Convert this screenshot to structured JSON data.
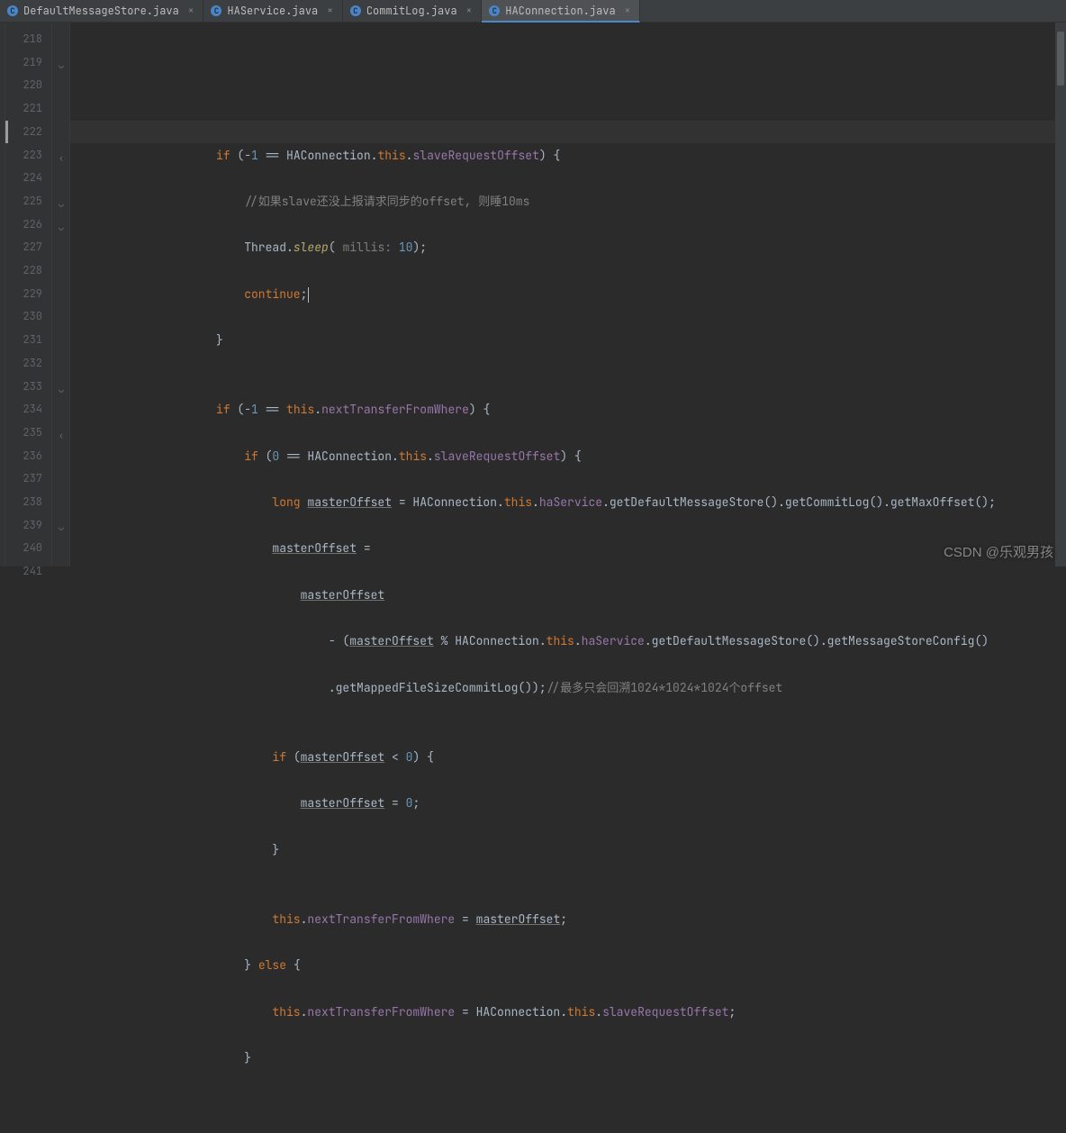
{
  "tabs": [
    {
      "label": "DefaultMessageStore.java"
    },
    {
      "label": "HAService.java"
    },
    {
      "label": "CommitLog.java"
    },
    {
      "label": "HAConnection.java"
    }
  ],
  "lines": {
    "start": 218,
    "end": 241
  },
  "code": {
    "t01": "if",
    "t02": " (-",
    "t03": "1",
    "t04": " == HAConnection.",
    "t05": "this",
    "t06": ".",
    "t07": "slaveRequestOffset",
    "t08": ") {",
    "t09": "//如果slave还没上报请求同步的offset, 则睡10ms",
    "t10": "Thread.",
    "t11": "sleep",
    "t12": "(",
    "t13": " millis: ",
    "t14": "10",
    "t15": ");",
    "t16": "continue",
    "t17": ";",
    "t18": "}",
    "t19": "if",
    "t20": " (-",
    "t21": "1",
    "t22": " == ",
    "t23": "this",
    "t24": ".",
    "t25": "nextTransferFromWhere",
    "t26": ") {",
    "t27": "if",
    "t28": " (",
    "t29": "0",
    "t30": " == HAConnection.",
    "t31": "this",
    "t32": ".",
    "t33": "slaveRequestOffset",
    "t34": ") {",
    "t35": "long",
    "t36": " ",
    "t37": "masterOffset",
    "t38": " = HAConnection.",
    "t39": "this",
    "t40": ".",
    "t41": "haService",
    "t42": ".getDefaultMessageStore().getCommitLog().getMaxOffset();",
    "t43": "masterOffset",
    "t44": " =",
    "t45": "masterOffset",
    "t46": "- (",
    "t47": "masterOffset",
    "t48": " % HAConnection.",
    "t49": "this",
    "t50": ".",
    "t51": "haService",
    "t52": ".getDefaultMessageStore().getMessageStoreConfig()",
    "t53": ".getMappedFileSizeCommitLog());",
    "t54": "//最多只会回溯1024*1024*1024个offset",
    "t55": "if",
    "t56": " (",
    "t57": "masterOffset",
    "t58": " < ",
    "t59": "0",
    "t60": ") {",
    "t61": "masterOffset",
    "t62": " = ",
    "t63": "0",
    "t64": ";",
    "t65": "}",
    "t66": "this",
    "t67": ".",
    "t68": "nextTransferFromWhere",
    "t69": " = ",
    "t70": "masterOffset",
    "t71": ";",
    "t72": "} ",
    "t73": "else",
    "t74": " {",
    "t75": "this",
    "t76": ".",
    "t77": "nextTransferFromWhere",
    "t78": " = HAConnection.",
    "t79": "this",
    "t80": ".",
    "t81": "slaveRequestOffset",
    "t82": ";",
    "t83": "}"
  },
  "watermark": "CSDN @乐观男孩"
}
